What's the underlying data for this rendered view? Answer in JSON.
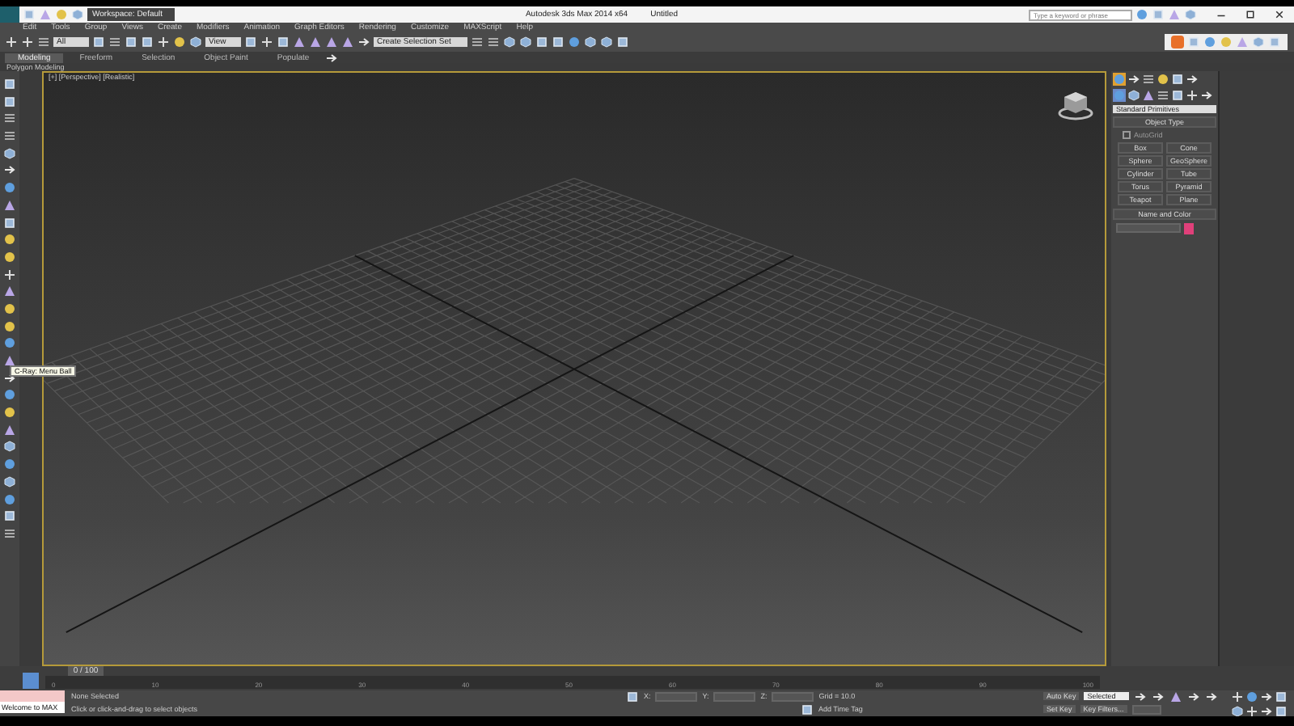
{
  "window": {
    "title": "Autodesk 3ds Max 2014 x64",
    "document": "Untitled",
    "workspace": "Workspace: Default",
    "search_placeholder": "Type a keyword or phrase"
  },
  "menu": [
    "Edit",
    "Tools",
    "Group",
    "Views",
    "Create",
    "Modifiers",
    "Animation",
    "Graph Editors",
    "Rendering",
    "Customize",
    "MAXScript",
    "Help"
  ],
  "toolbar": {
    "selection_filter": "All",
    "reference_coord": "View",
    "named_selection": "Create Selection Set"
  },
  "ribbon": {
    "tabs": [
      {
        "label": "Modeling",
        "selected": true
      },
      {
        "label": "Freeform",
        "selected": false
      },
      {
        "label": "Selection",
        "selected": false
      },
      {
        "label": "Object Paint",
        "selected": false
      },
      {
        "label": "Populate",
        "selected": false
      }
    ],
    "panel": "Polygon Modeling"
  },
  "viewport": {
    "label": "[+] [Perspective] [Realistic]"
  },
  "tooltip": "C-Ray: Menu Ball",
  "command_panel": {
    "tabs": [
      {
        "selected": true
      },
      {
        "selected": false
      },
      {
        "selected": false
      },
      {
        "selected": false
      },
      {
        "selected": false
      },
      {
        "selected": false
      }
    ],
    "subtabs": [
      {
        "selected": true
      },
      {
        "selected": false
      },
      {
        "selected": false
      },
      {
        "selected": false
      },
      {
        "selected": false
      },
      {
        "selected": false
      },
      {
        "selected": false
      }
    ],
    "category": "Standard Primitives",
    "object_type": "Object Type",
    "autogrid": {
      "label": "AutoGrid",
      "checked": false
    },
    "buttons": [
      "Box",
      "Cone",
      "Sphere",
      "GeoSphere",
      "Cylinder",
      "Tube",
      "Torus",
      "Pyramid",
      "Teapot",
      "Plane"
    ],
    "name_and_color": "Name and Color",
    "color": "#e0407a"
  },
  "timeline": {
    "frame": "0 / 100",
    "level": 0,
    "ticks": [
      "0",
      "10",
      "20",
      "30",
      "40",
      "50",
      "60",
      "70",
      "80",
      "90",
      "100"
    ]
  },
  "status": {
    "maxscript": "Welcome to MAX",
    "selection": "None Selected",
    "prompt": "Click or click-and-drag to select objects",
    "x": "X:",
    "y": "Y:",
    "z": "Z:",
    "grid": "Grid = 10.0",
    "add_time_tag": "Add Time Tag",
    "auto_key": "Auto Key",
    "key_mode": "Selected",
    "set_key": "Set Key",
    "key_filters": "Key Filters..."
  }
}
